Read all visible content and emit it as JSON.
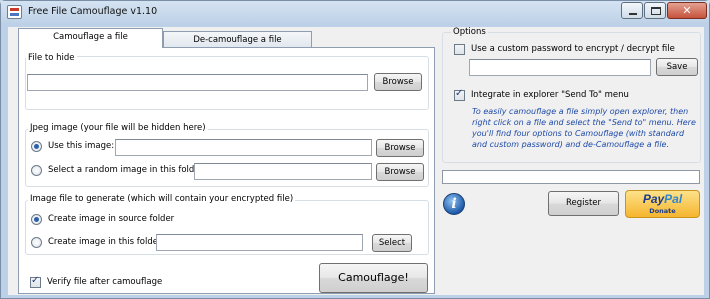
{
  "window": {
    "title": "Free File Camouflage v1.10",
    "close_glyph": "✕"
  },
  "tabs": [
    {
      "label": "Camouflage a file",
      "active": true
    },
    {
      "label": "De-camouflage a file",
      "active": false
    }
  ],
  "file_to_hide": {
    "label": "File to hide",
    "value": "",
    "browse_label": "Browse"
  },
  "jpeg_group": {
    "label": "Jpeg image (your file will be hidden here)",
    "use_this_image": {
      "label": "Use this image:",
      "checked": true,
      "value": "",
      "browse_label": "Browse"
    },
    "random_image": {
      "label": "Select a random image in this folder:",
      "checked": false,
      "value": "",
      "browse_label": "Browse"
    }
  },
  "generate_group": {
    "label": "Image file to generate (which will contain your encrypted file)",
    "source_folder": {
      "label": "Create image in source folder",
      "checked": true
    },
    "this_folder": {
      "label": "Create image in this folder:",
      "checked": false,
      "value": "",
      "select_label": "Select"
    }
  },
  "verify": {
    "label": "Verify file after camouflage",
    "checked": true
  },
  "camouflage_button": "Camouflage!",
  "options": {
    "label": "Options",
    "custom_password": {
      "label": "Use a custom password to encrypt / decrypt file",
      "checked": false,
      "value": "",
      "save_label": "Save"
    },
    "send_to": {
      "label": "Integrate in explorer \"Send To\" menu",
      "checked": true
    },
    "info_text": "To easily camouflage a file simply open explorer, then right click on a file and select the \"Send to\" menu. Here you'll find four options to Camouflage (with standard and custom password) and de-Camouflage a file."
  },
  "progress": {
    "value": 0
  },
  "info_icon_glyph": "i",
  "register_label": "Register",
  "paypal": {
    "brand_part1": "Pay",
    "brand_part2": "Pal",
    "donate_label": "Donate"
  }
}
